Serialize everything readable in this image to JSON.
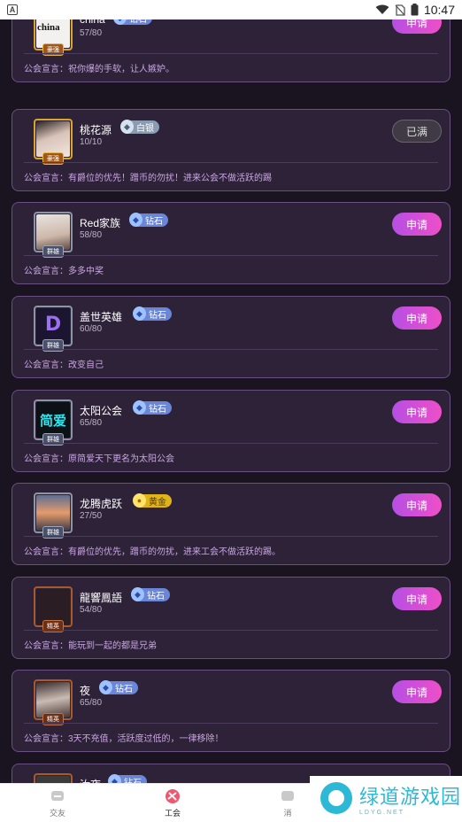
{
  "status_bar": {
    "time": "10:47",
    "app_badge": "A"
  },
  "guilds": [
    {
      "name": "china",
      "tier": "钻石",
      "tier_class": "diamond",
      "count": "57/80",
      "motto": "祝你爆的手软，让人嫉妒。",
      "button": "申请",
      "button_state": "apply",
      "rank": "豪强",
      "avatar_text": "china"
    },
    {
      "name": "桃花源",
      "tier": "白银",
      "tier_class": "silver",
      "count": "10/10",
      "motto": "有爵位的优先！蹭币的勿扰！进来公会不做活跃的踢",
      "button": "已满",
      "button_state": "full",
      "rank": "豪强",
      "avatar_text": ""
    },
    {
      "name": "Red家族",
      "tier": "钻石",
      "tier_class": "diamond",
      "count": "58/80",
      "motto": "多多中奖",
      "button": "申请",
      "button_state": "apply",
      "rank": "群雄",
      "avatar_text": ""
    },
    {
      "name": "盖世英雄",
      "tier": "钻石",
      "tier_class": "diamond",
      "count": "60/80",
      "motto": "改变自己",
      "button": "申请",
      "button_state": "apply",
      "rank": "群雄",
      "avatar_text": "D"
    },
    {
      "name": "太阳公会",
      "tier": "钻石",
      "tier_class": "diamond",
      "count": "65/80",
      "motto": "原简爱天下更名为太阳公会",
      "button": "申请",
      "button_state": "apply",
      "rank": "群雄",
      "avatar_text": "简爱"
    },
    {
      "name": "龙腾虎跃",
      "tier": "黄金",
      "tier_class": "gold",
      "count": "27/50",
      "motto": "有爵位的优先，蹭币的勿扰，进来工会不做活跃的踢。",
      "button": "申请",
      "button_state": "apply",
      "rank": "群雄",
      "avatar_text": ""
    },
    {
      "name": "龍響鳳語",
      "tier": "钻石",
      "tier_class": "diamond",
      "count": "54/80",
      "motto": "能玩到一起的都是兄弟",
      "button": "申请",
      "button_state": "apply",
      "rank": "精英",
      "avatar_text": ""
    },
    {
      "name": "夜",
      "tier": "钻石",
      "tier_class": "diamond",
      "count": "65/80",
      "motto": "3天不充值，活跃度过低的，一律移除！",
      "button": "申请",
      "button_state": "apply",
      "rank": "精英",
      "avatar_text": ""
    },
    {
      "name": "汝夜",
      "tier": "钻石",
      "tier_class": "diamond",
      "count": "",
      "motto": "",
      "button": "",
      "button_state": "apply",
      "rank": "",
      "avatar_text": ""
    }
  ],
  "motto_label": "公会宣言：",
  "tabs": [
    {
      "label": "交友",
      "icon": "chat-icon",
      "active": false
    },
    {
      "label": "工会",
      "icon": "guild-icon",
      "active": true
    },
    {
      "label": "消",
      "icon": "message-icon",
      "active": false
    }
  ],
  "watermark": {
    "title": "绿道游戏园",
    "subtitle": "LDYG.NET"
  },
  "colors": {
    "background": "#1a1320",
    "card": "#2e2238",
    "card_border": "#6a4f82",
    "apply_gradient_start": "#b54fe3",
    "apply_gradient_end": "#ee4fc8",
    "motto": "#c9a6e3"
  }
}
